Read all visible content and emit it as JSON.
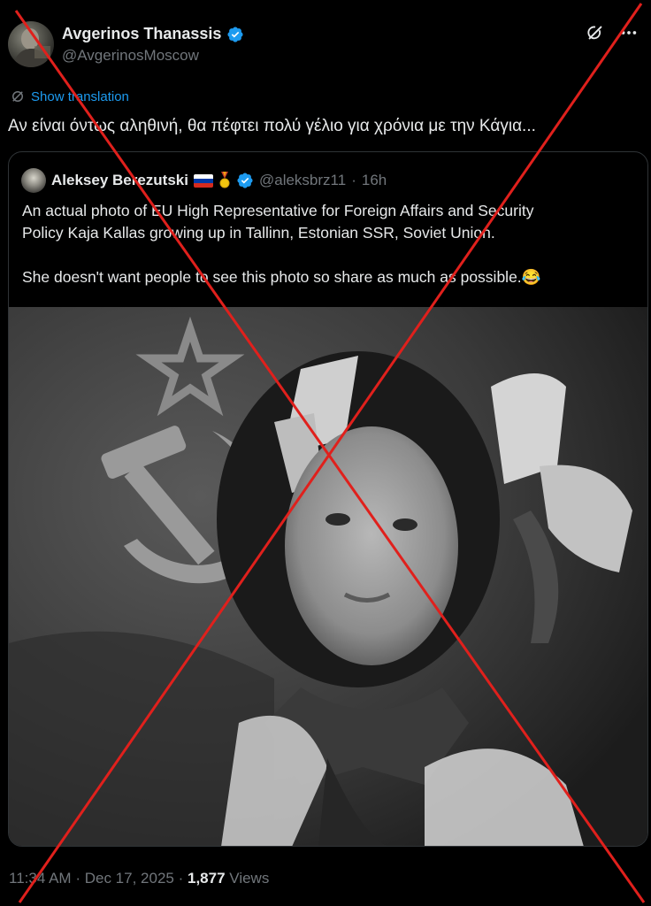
{
  "post": {
    "author_name": "Avgerinos Thanassis",
    "author_handle": "@AvgerinosMoscow",
    "show_translation": "Show translation",
    "text": "Αν είναι όντως αληθινή, θα πέφτει πολύ γέλιο για χρόνια με την Κάγια...",
    "time": "11:34 AM",
    "date": "Dec 17, 2025",
    "views_count": "1,877",
    "views_label": "Views",
    "separator": "·"
  },
  "quote": {
    "author_name": "Aleksey Berezutski",
    "author_handle": "@aleksbrz11",
    "age": "16h",
    "separator": "·",
    "text_line1": "An actual photo of EU High Representative for Foreign Affairs and Security",
    "text_line2": "Policy Kaja Kallas growing up in Tallinn, Estonian SSR, Soviet Union.",
    "text_line3": "She doesn't want people to see this photo so share as much as possible.😂"
  },
  "icons": {
    "verified": "verified-badge-icon",
    "grok": "grok-icon",
    "more": "more-options-icon",
    "translate": "translate-icon",
    "flag": "russia-flag-icon",
    "medal": "medal-icon"
  },
  "colors": {
    "background": "#000000",
    "text": "#e7e9ea",
    "muted": "#71767b",
    "accent": "#1d9bf0",
    "cross": "#e0201c"
  }
}
